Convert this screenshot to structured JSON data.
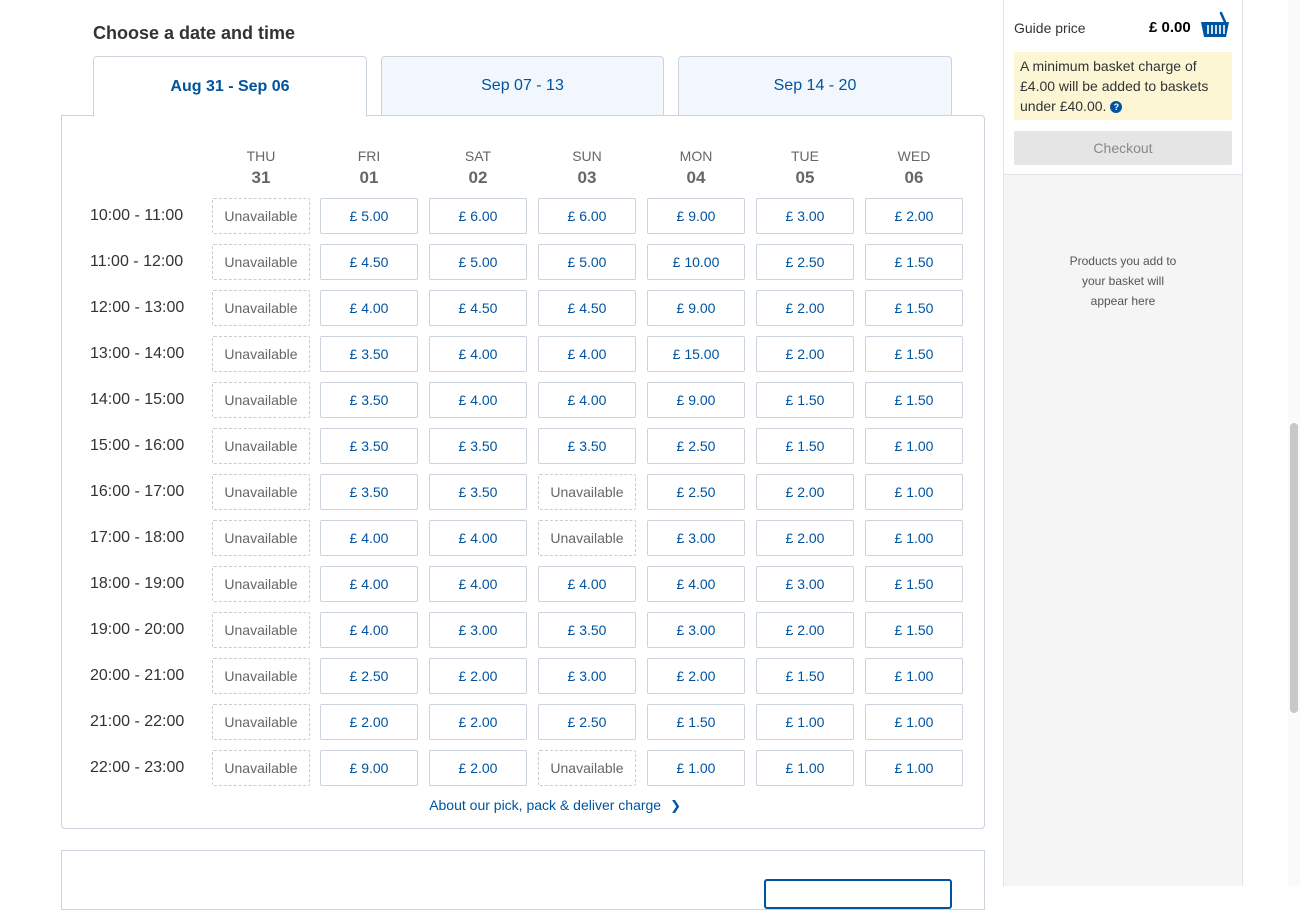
{
  "heading": "Choose a date and time",
  "week_tabs": [
    {
      "label": "Aug 31 - Sep 06",
      "active": true
    },
    {
      "label": "Sep 07 - 13",
      "active": false
    },
    {
      "label": "Sep 14 - 20",
      "active": false
    }
  ],
  "days": [
    {
      "name": "THU",
      "num": "31"
    },
    {
      "name": "FRI",
      "num": "01"
    },
    {
      "name": "SAT",
      "num": "02"
    },
    {
      "name": "SUN",
      "num": "03"
    },
    {
      "name": "MON",
      "num": "04"
    },
    {
      "name": "TUE",
      "num": "05"
    },
    {
      "name": "WED",
      "num": "06"
    }
  ],
  "rows": [
    {
      "time": "10:00 - 11:00",
      "slots": [
        "Unavailable",
        "£ 5.00",
        "£ 6.00",
        "£ 6.00",
        "£ 9.00",
        "£ 3.00",
        "£ 2.00"
      ]
    },
    {
      "time": "11:00 - 12:00",
      "slots": [
        "Unavailable",
        "£ 4.50",
        "£ 5.00",
        "£ 5.00",
        "£ 10.00",
        "£ 2.50",
        "£ 1.50"
      ]
    },
    {
      "time": "12:00 - 13:00",
      "slots": [
        "Unavailable",
        "£ 4.00",
        "£ 4.50",
        "£ 4.50",
        "£ 9.00",
        "£ 2.00",
        "£ 1.50"
      ]
    },
    {
      "time": "13:00 - 14:00",
      "slots": [
        "Unavailable",
        "£ 3.50",
        "£ 4.00",
        "£ 4.00",
        "£ 15.00",
        "£ 2.00",
        "£ 1.50"
      ]
    },
    {
      "time": "14:00 - 15:00",
      "slots": [
        "Unavailable",
        "£ 3.50",
        "£ 4.00",
        "£ 4.00",
        "£ 9.00",
        "£ 1.50",
        "£ 1.50"
      ]
    },
    {
      "time": "15:00 - 16:00",
      "slots": [
        "Unavailable",
        "£ 3.50",
        "£ 3.50",
        "£ 3.50",
        "£ 2.50",
        "£ 1.50",
        "£ 1.00"
      ]
    },
    {
      "time": "16:00 - 17:00",
      "slots": [
        "Unavailable",
        "£ 3.50",
        "£ 3.50",
        "Unavailable",
        "£ 2.50",
        "£ 2.00",
        "£ 1.00"
      ]
    },
    {
      "time": "17:00 - 18:00",
      "slots": [
        "Unavailable",
        "£ 4.00",
        "£ 4.00",
        "Unavailable",
        "£ 3.00",
        "£ 2.00",
        "£ 1.00"
      ]
    },
    {
      "time": "18:00 - 19:00",
      "slots": [
        "Unavailable",
        "£ 4.00",
        "£ 4.00",
        "£ 4.00",
        "£ 4.00",
        "£ 3.00",
        "£ 1.50"
      ]
    },
    {
      "time": "19:00 - 20:00",
      "slots": [
        "Unavailable",
        "£ 4.00",
        "£ 3.00",
        "£ 3.50",
        "£ 3.00",
        "£ 2.00",
        "£ 1.50"
      ]
    },
    {
      "time": "20:00 - 21:00",
      "slots": [
        "Unavailable",
        "£ 2.50",
        "£ 2.00",
        "£ 3.00",
        "£ 2.00",
        "£ 1.50",
        "£ 1.00"
      ]
    },
    {
      "time": "21:00 - 22:00",
      "slots": [
        "Unavailable",
        "£ 2.00",
        "£ 2.00",
        "£ 2.50",
        "£ 1.50",
        "£ 1.00",
        "£ 1.00"
      ]
    },
    {
      "time": "22:00 - 23:00",
      "slots": [
        "Unavailable",
        "£ 9.00",
        "£ 2.00",
        "Unavailable",
        "£ 1.00",
        "£ 1.00",
        "£ 1.00"
      ]
    }
  ],
  "about_link": "About our pick, pack & deliver charge",
  "unavailable_label": "Unavailable",
  "basket": {
    "guide_label": "Guide price",
    "guide_value": "£ 0.00",
    "icon": "basket-icon",
    "min_note": "A minimum basket charge of £4.00 will be added to baskets under £40.00.",
    "help_glyph": "?",
    "checkout_label": "Checkout",
    "empty_msg": "Products you add to your basket will appear here"
  },
  "colors": {
    "brand_blue": "#00539f",
    "border": "#cbd3dc",
    "note_bg": "#fdf6d4",
    "inactive_tab_bg": "#f1f7fd"
  }
}
